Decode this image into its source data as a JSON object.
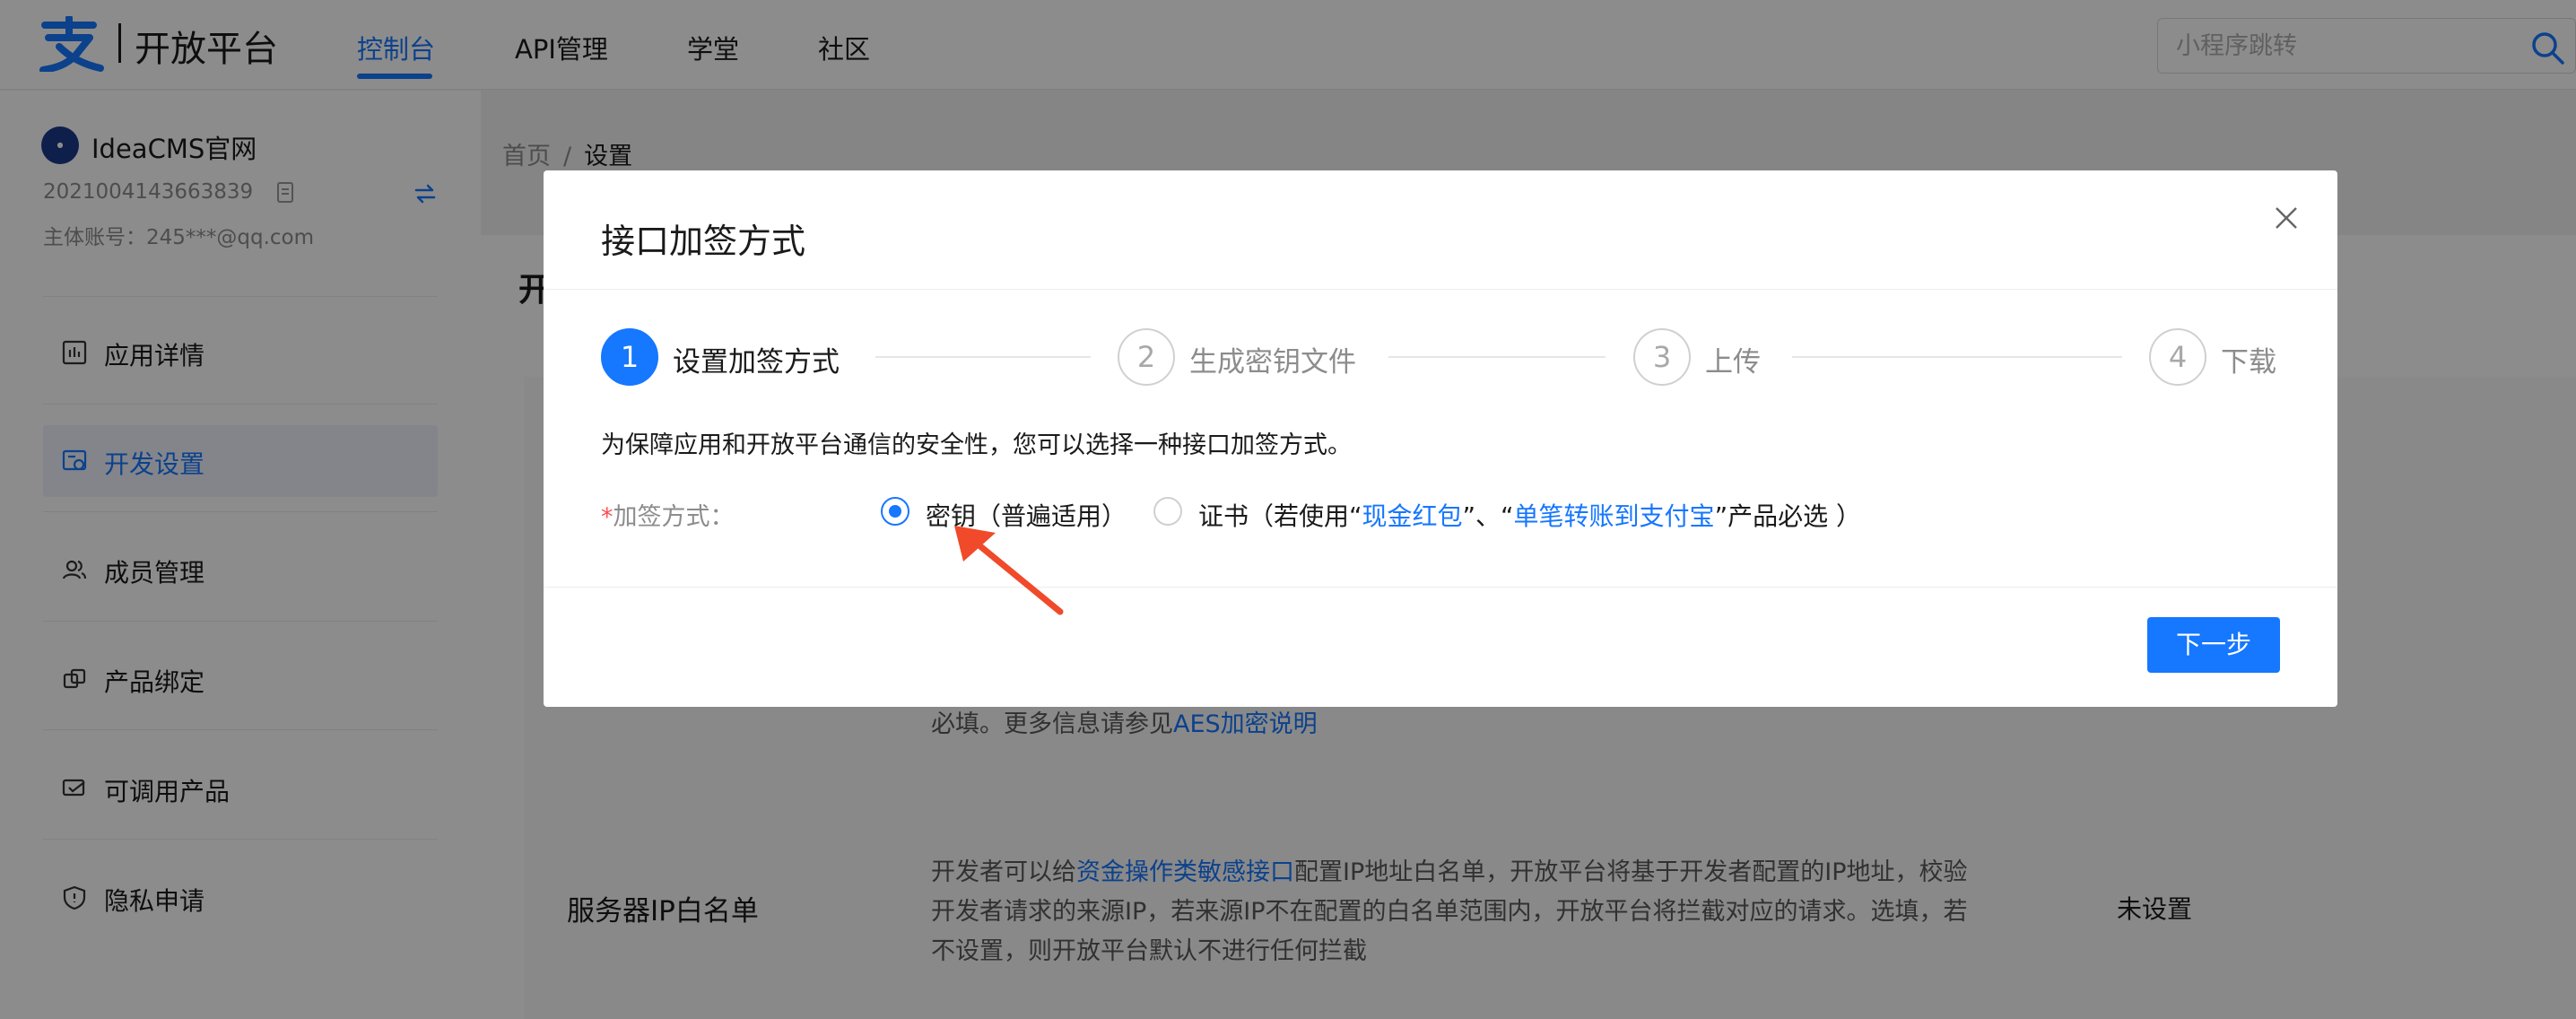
{
  "header": {
    "logo_text": "开放平台",
    "nav": [
      {
        "label": "控制台",
        "active": true
      },
      {
        "label": "API管理"
      },
      {
        "label": "学堂"
      },
      {
        "label": "社区"
      }
    ],
    "search_placeholder": "小程序跳转"
  },
  "sidebar": {
    "app_name": "IdeaCMS官网",
    "app_id": "2021004143663839",
    "account": "主体账号：245***@qq.com",
    "menu": [
      {
        "label": "应用详情",
        "icon": "chart-icon"
      },
      {
        "label": "开发设置",
        "icon": "settings-icon",
        "active": true
      },
      {
        "label": "成员管理",
        "icon": "members-icon"
      },
      {
        "label": "产品绑定",
        "icon": "bind-icon"
      },
      {
        "label": "可调用产品",
        "icon": "product-icon"
      },
      {
        "label": "隐私申请",
        "icon": "shield-icon"
      }
    ]
  },
  "breadcrumb": {
    "home": "首页",
    "sep": "/",
    "current": "设置"
  },
  "background": {
    "card_title_fragment": "开",
    "aes_text": "必填。更多信息请参见",
    "aes_link": "AES加密说明",
    "ip_label": "服务器IP白名单",
    "ip_desc_1_pre": "开发者可以给",
    "ip_desc_1_link": "资金操作类敏感接口",
    "ip_desc_1_post": "配置IP地址白名单，开放平台将基于开发者配置的IP地址，校验",
    "ip_desc_2": "开发者请求的来源IP，若来源IP不在配置的白名单范围内，开放平台将拦截对应的请求。选填，若",
    "ip_desc_3": "不设置，则开放平台默认不进行任何拦截",
    "ip_status": "未设置"
  },
  "modal": {
    "title": "接口加签方式",
    "steps": [
      {
        "num": "1",
        "label": "设置加签方式",
        "active": true
      },
      {
        "num": "2",
        "label": "生成密钥文件"
      },
      {
        "num": "3",
        "label": "上传"
      },
      {
        "num": "4",
        "label": "下载"
      }
    ],
    "description": "为保障应用和开放平台通信的安全性，您可以选择一种接口加签方式。",
    "field_required": "*",
    "field_label": "加签方式：",
    "option_key": "密钥（普遍适用）",
    "option_cert_pre": "证书（若使用“",
    "option_cert_link1": "现金红包",
    "option_cert_mid": "”、“",
    "option_cert_link2": "单笔转账到支付宝",
    "option_cert_post": "”产品必选 ）",
    "selected_option": "密钥（普遍适用）",
    "next_button": "下一步"
  },
  "colors": {
    "accent": "#1677ff",
    "annotation_arrow": "#f04a2a"
  }
}
